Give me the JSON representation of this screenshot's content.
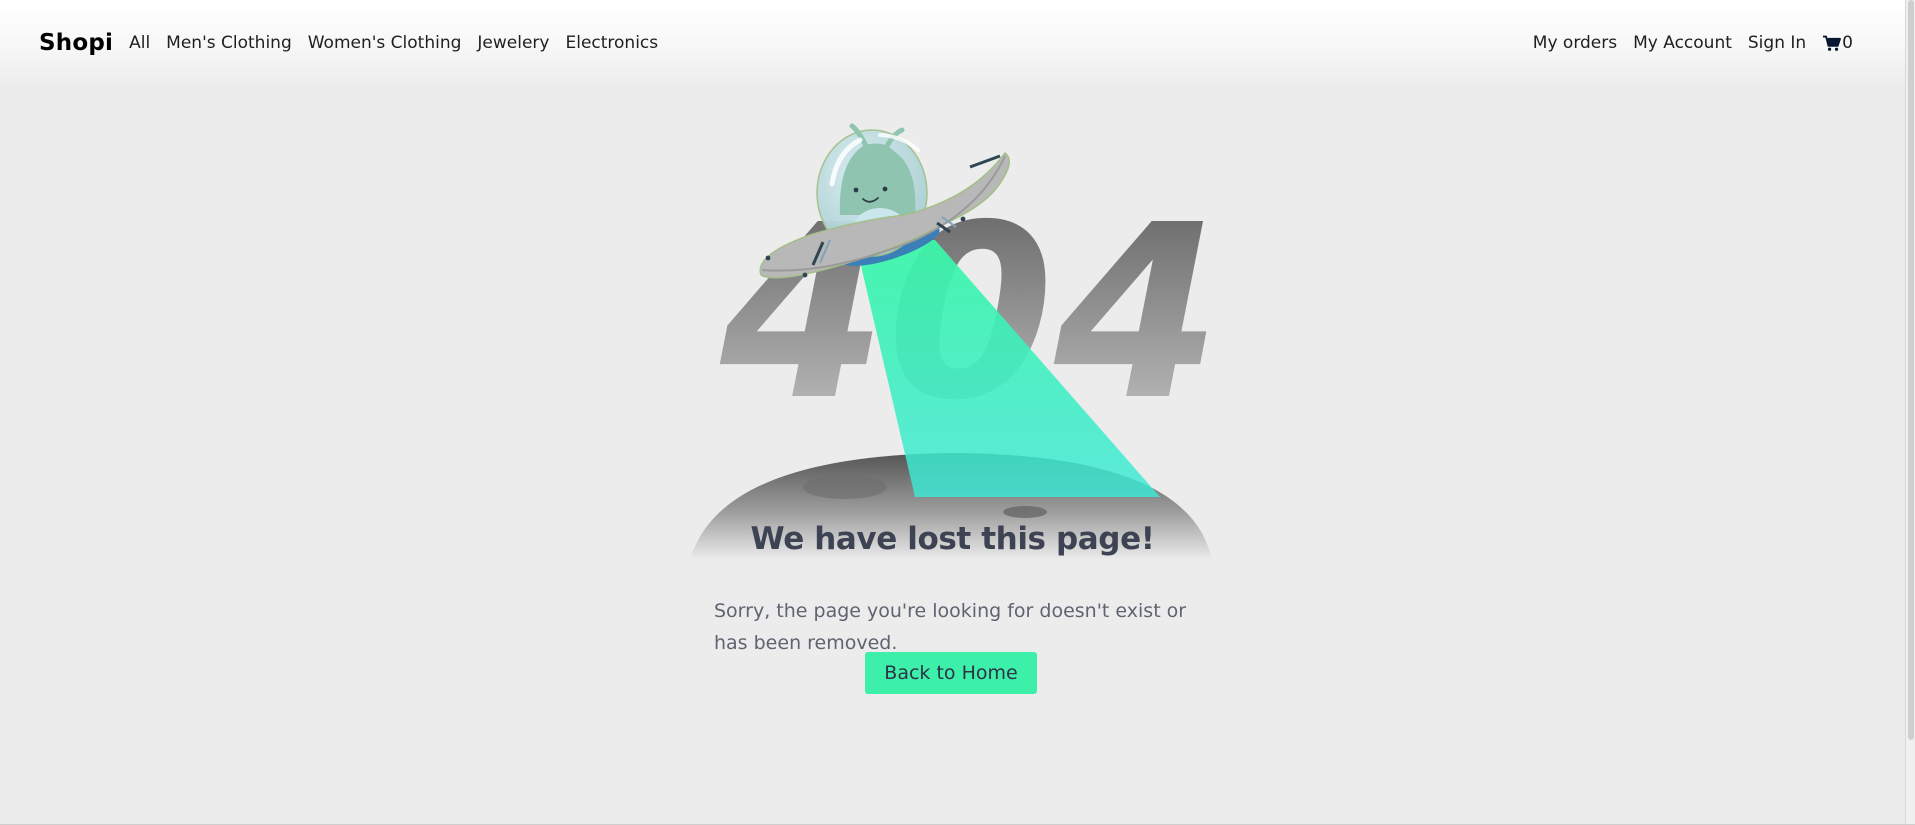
{
  "navbar": {
    "brand": "Shopi",
    "categories": [
      {
        "label": "All"
      },
      {
        "label": "Men's Clothing"
      },
      {
        "label": "Women's Clothing"
      },
      {
        "label": "Jewelery"
      },
      {
        "label": "Electronics"
      }
    ],
    "account_links": [
      {
        "label": "My orders"
      },
      {
        "label": "My Account"
      },
      {
        "label": "Sign In"
      }
    ],
    "cart": {
      "icon": "shopping-cart-icon",
      "count": "0"
    }
  },
  "illustration": {
    "code": "404",
    "icon": "ufo-alien-icon"
  },
  "message": {
    "title": "We have lost this page!",
    "description": "Sorry, the page you're looking for doesn't exist or has been removed.",
    "button_label": "Back to Home"
  },
  "colors": {
    "background": "#ececec",
    "accent": "#3df0a9",
    "beam": "#3ce9c9",
    "title": "#3d4352",
    "text": "#5f6470"
  }
}
